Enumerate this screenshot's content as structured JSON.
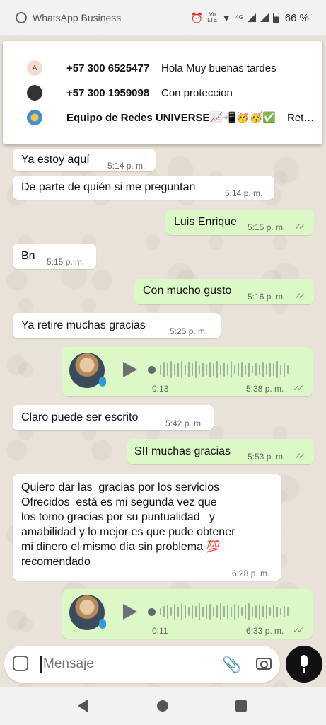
{
  "status_bar": {
    "app_name": "WhatsApp Business",
    "volte_top": "Vo",
    "volte_bottom": "LTE",
    "network": "4G",
    "battery": "66 %"
  },
  "notifications": [
    {
      "avatar": "A",
      "sender": "+57 300 6525477",
      "text": "Hola Muy buenas tardes"
    },
    {
      "avatar": "",
      "sender": "+57 300 1959098",
      "text": "Con proteccion"
    },
    {
      "avatar": "",
      "sender": "Equipo  de Redes UNIVERSE📈📲🥳🥳✅",
      "text": "Ret…"
    }
  ],
  "messages": [
    {
      "dir": "in",
      "text": "Ya estoy aquí",
      "time": "5:14 p. m."
    },
    {
      "dir": "in",
      "text": "De parte de quién si me preguntan",
      "time": "5:14 p. m."
    },
    {
      "dir": "out",
      "text": "Luis Enrique",
      "time": "5:15 p. m."
    },
    {
      "dir": "in",
      "text": "Bn",
      "time": "5:15 p. m."
    },
    {
      "dir": "out",
      "text": "Con mucho gusto",
      "time": "5:16 p. m."
    },
    {
      "dir": "in",
      "text": "Ya retire muchas gracias",
      "time": "5:25 p. m."
    },
    {
      "dir": "out",
      "type": "voice",
      "duration": "0:13",
      "time": "5:38 p. m."
    },
    {
      "dir": "in",
      "text": "Claro  puede ser escrito",
      "time": "5:42 p. m."
    },
    {
      "dir": "out",
      "text": "SII muchas gracias",
      "time": "5:53 p. m."
    },
    {
      "dir": "in",
      "text": "Quiero dar las  gracias por los servicios\nOfrecidos  está es mi segunda vez que\nlos tomo gracias por su puntualidad   y\namabilidad y lo mejor es que pude obtener\nmi dinero el mismo día sin problema 💯\nrecomendado",
      "time": "6:28 p. m."
    },
    {
      "dir": "out",
      "type": "voice",
      "duration": "0:11",
      "time": "6:33 p. m."
    }
  ],
  "input": {
    "placeholder": "Mensaje"
  },
  "icons": {
    "ticks": "✓✓",
    "clip": "📎"
  },
  "colors": {
    "incoming_bubble": "#ffffff",
    "outgoing_bubble": "#dcf8c6",
    "read_ticks": "#888888"
  }
}
